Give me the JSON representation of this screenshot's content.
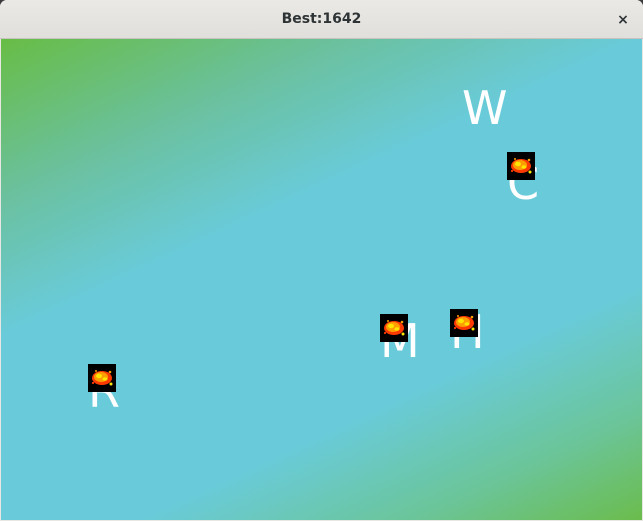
{
  "window": {
    "title": "Best:1642",
    "close_glyph": "×"
  },
  "game": {
    "background": [
      "#68bd45",
      "#69cbd9",
      "#6bbc4c"
    ],
    "falling_letters": [
      {
        "char": "W"
      },
      {
        "char": "C"
      },
      {
        "char": "M"
      },
      {
        "char": "H"
      },
      {
        "char": "R"
      }
    ],
    "explosion_icon": "explosion-icon",
    "explosion_colors": [
      "#ff3a00",
      "#ff9e00",
      "#ffe600"
    ]
  }
}
